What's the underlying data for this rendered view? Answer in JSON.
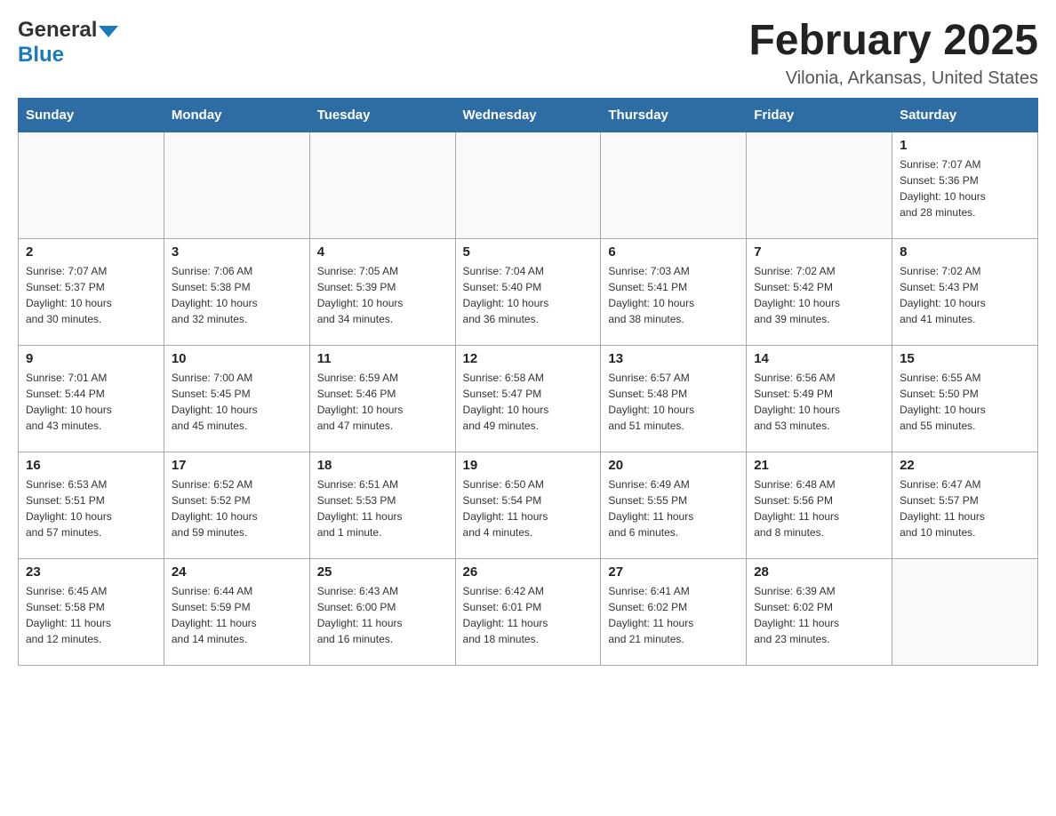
{
  "header": {
    "logo_general": "General",
    "logo_blue": "Blue",
    "title": "February 2025",
    "subtitle": "Vilonia, Arkansas, United States"
  },
  "days_of_week": [
    "Sunday",
    "Monday",
    "Tuesday",
    "Wednesday",
    "Thursday",
    "Friday",
    "Saturday"
  ],
  "weeks": [
    [
      {
        "day": "",
        "info": ""
      },
      {
        "day": "",
        "info": ""
      },
      {
        "day": "",
        "info": ""
      },
      {
        "day": "",
        "info": ""
      },
      {
        "day": "",
        "info": ""
      },
      {
        "day": "",
        "info": ""
      },
      {
        "day": "1",
        "info": "Sunrise: 7:07 AM\nSunset: 5:36 PM\nDaylight: 10 hours\nand 28 minutes."
      }
    ],
    [
      {
        "day": "2",
        "info": "Sunrise: 7:07 AM\nSunset: 5:37 PM\nDaylight: 10 hours\nand 30 minutes."
      },
      {
        "day": "3",
        "info": "Sunrise: 7:06 AM\nSunset: 5:38 PM\nDaylight: 10 hours\nand 32 minutes."
      },
      {
        "day": "4",
        "info": "Sunrise: 7:05 AM\nSunset: 5:39 PM\nDaylight: 10 hours\nand 34 minutes."
      },
      {
        "day": "5",
        "info": "Sunrise: 7:04 AM\nSunset: 5:40 PM\nDaylight: 10 hours\nand 36 minutes."
      },
      {
        "day": "6",
        "info": "Sunrise: 7:03 AM\nSunset: 5:41 PM\nDaylight: 10 hours\nand 38 minutes."
      },
      {
        "day": "7",
        "info": "Sunrise: 7:02 AM\nSunset: 5:42 PM\nDaylight: 10 hours\nand 39 minutes."
      },
      {
        "day": "8",
        "info": "Sunrise: 7:02 AM\nSunset: 5:43 PM\nDaylight: 10 hours\nand 41 minutes."
      }
    ],
    [
      {
        "day": "9",
        "info": "Sunrise: 7:01 AM\nSunset: 5:44 PM\nDaylight: 10 hours\nand 43 minutes."
      },
      {
        "day": "10",
        "info": "Sunrise: 7:00 AM\nSunset: 5:45 PM\nDaylight: 10 hours\nand 45 minutes."
      },
      {
        "day": "11",
        "info": "Sunrise: 6:59 AM\nSunset: 5:46 PM\nDaylight: 10 hours\nand 47 minutes."
      },
      {
        "day": "12",
        "info": "Sunrise: 6:58 AM\nSunset: 5:47 PM\nDaylight: 10 hours\nand 49 minutes."
      },
      {
        "day": "13",
        "info": "Sunrise: 6:57 AM\nSunset: 5:48 PM\nDaylight: 10 hours\nand 51 minutes."
      },
      {
        "day": "14",
        "info": "Sunrise: 6:56 AM\nSunset: 5:49 PM\nDaylight: 10 hours\nand 53 minutes."
      },
      {
        "day": "15",
        "info": "Sunrise: 6:55 AM\nSunset: 5:50 PM\nDaylight: 10 hours\nand 55 minutes."
      }
    ],
    [
      {
        "day": "16",
        "info": "Sunrise: 6:53 AM\nSunset: 5:51 PM\nDaylight: 10 hours\nand 57 minutes."
      },
      {
        "day": "17",
        "info": "Sunrise: 6:52 AM\nSunset: 5:52 PM\nDaylight: 10 hours\nand 59 minutes."
      },
      {
        "day": "18",
        "info": "Sunrise: 6:51 AM\nSunset: 5:53 PM\nDaylight: 11 hours\nand 1 minute."
      },
      {
        "day": "19",
        "info": "Sunrise: 6:50 AM\nSunset: 5:54 PM\nDaylight: 11 hours\nand 4 minutes."
      },
      {
        "day": "20",
        "info": "Sunrise: 6:49 AM\nSunset: 5:55 PM\nDaylight: 11 hours\nand 6 minutes."
      },
      {
        "day": "21",
        "info": "Sunrise: 6:48 AM\nSunset: 5:56 PM\nDaylight: 11 hours\nand 8 minutes."
      },
      {
        "day": "22",
        "info": "Sunrise: 6:47 AM\nSunset: 5:57 PM\nDaylight: 11 hours\nand 10 minutes."
      }
    ],
    [
      {
        "day": "23",
        "info": "Sunrise: 6:45 AM\nSunset: 5:58 PM\nDaylight: 11 hours\nand 12 minutes."
      },
      {
        "day": "24",
        "info": "Sunrise: 6:44 AM\nSunset: 5:59 PM\nDaylight: 11 hours\nand 14 minutes."
      },
      {
        "day": "25",
        "info": "Sunrise: 6:43 AM\nSunset: 6:00 PM\nDaylight: 11 hours\nand 16 minutes."
      },
      {
        "day": "26",
        "info": "Sunrise: 6:42 AM\nSunset: 6:01 PM\nDaylight: 11 hours\nand 18 minutes."
      },
      {
        "day": "27",
        "info": "Sunrise: 6:41 AM\nSunset: 6:02 PM\nDaylight: 11 hours\nand 21 minutes."
      },
      {
        "day": "28",
        "info": "Sunrise: 6:39 AM\nSunset: 6:02 PM\nDaylight: 11 hours\nand 23 minutes."
      },
      {
        "day": "",
        "info": ""
      }
    ]
  ]
}
